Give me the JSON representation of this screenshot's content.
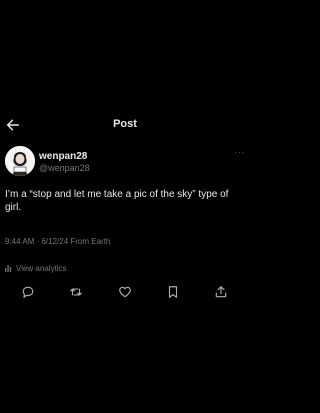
{
  "header": {
    "title": "Post",
    "back_icon": "arrow-left-icon"
  },
  "author": {
    "display_name": "wenpan28",
    "handle": "@wenpan28",
    "more_label": "···"
  },
  "tweet": {
    "text": "I’m a “stop and let me take a pic of the sky” type of girl.",
    "timestamp": "9:44 AM · 6/12/24 From Earth"
  },
  "analytics": {
    "label": "View analytics",
    "icon": "bar-chart-icon"
  },
  "actions": [
    {
      "name": "reply",
      "icon": "comment-icon"
    },
    {
      "name": "repost",
      "icon": "retweet-icon"
    },
    {
      "name": "like",
      "icon": "heart-icon"
    },
    {
      "name": "bookmark",
      "icon": "bookmark-icon"
    },
    {
      "name": "share",
      "icon": "share-icon"
    }
  ],
  "colors": {
    "background": "#000000",
    "text": "#e7e9ea",
    "secondary": "#71767b"
  }
}
